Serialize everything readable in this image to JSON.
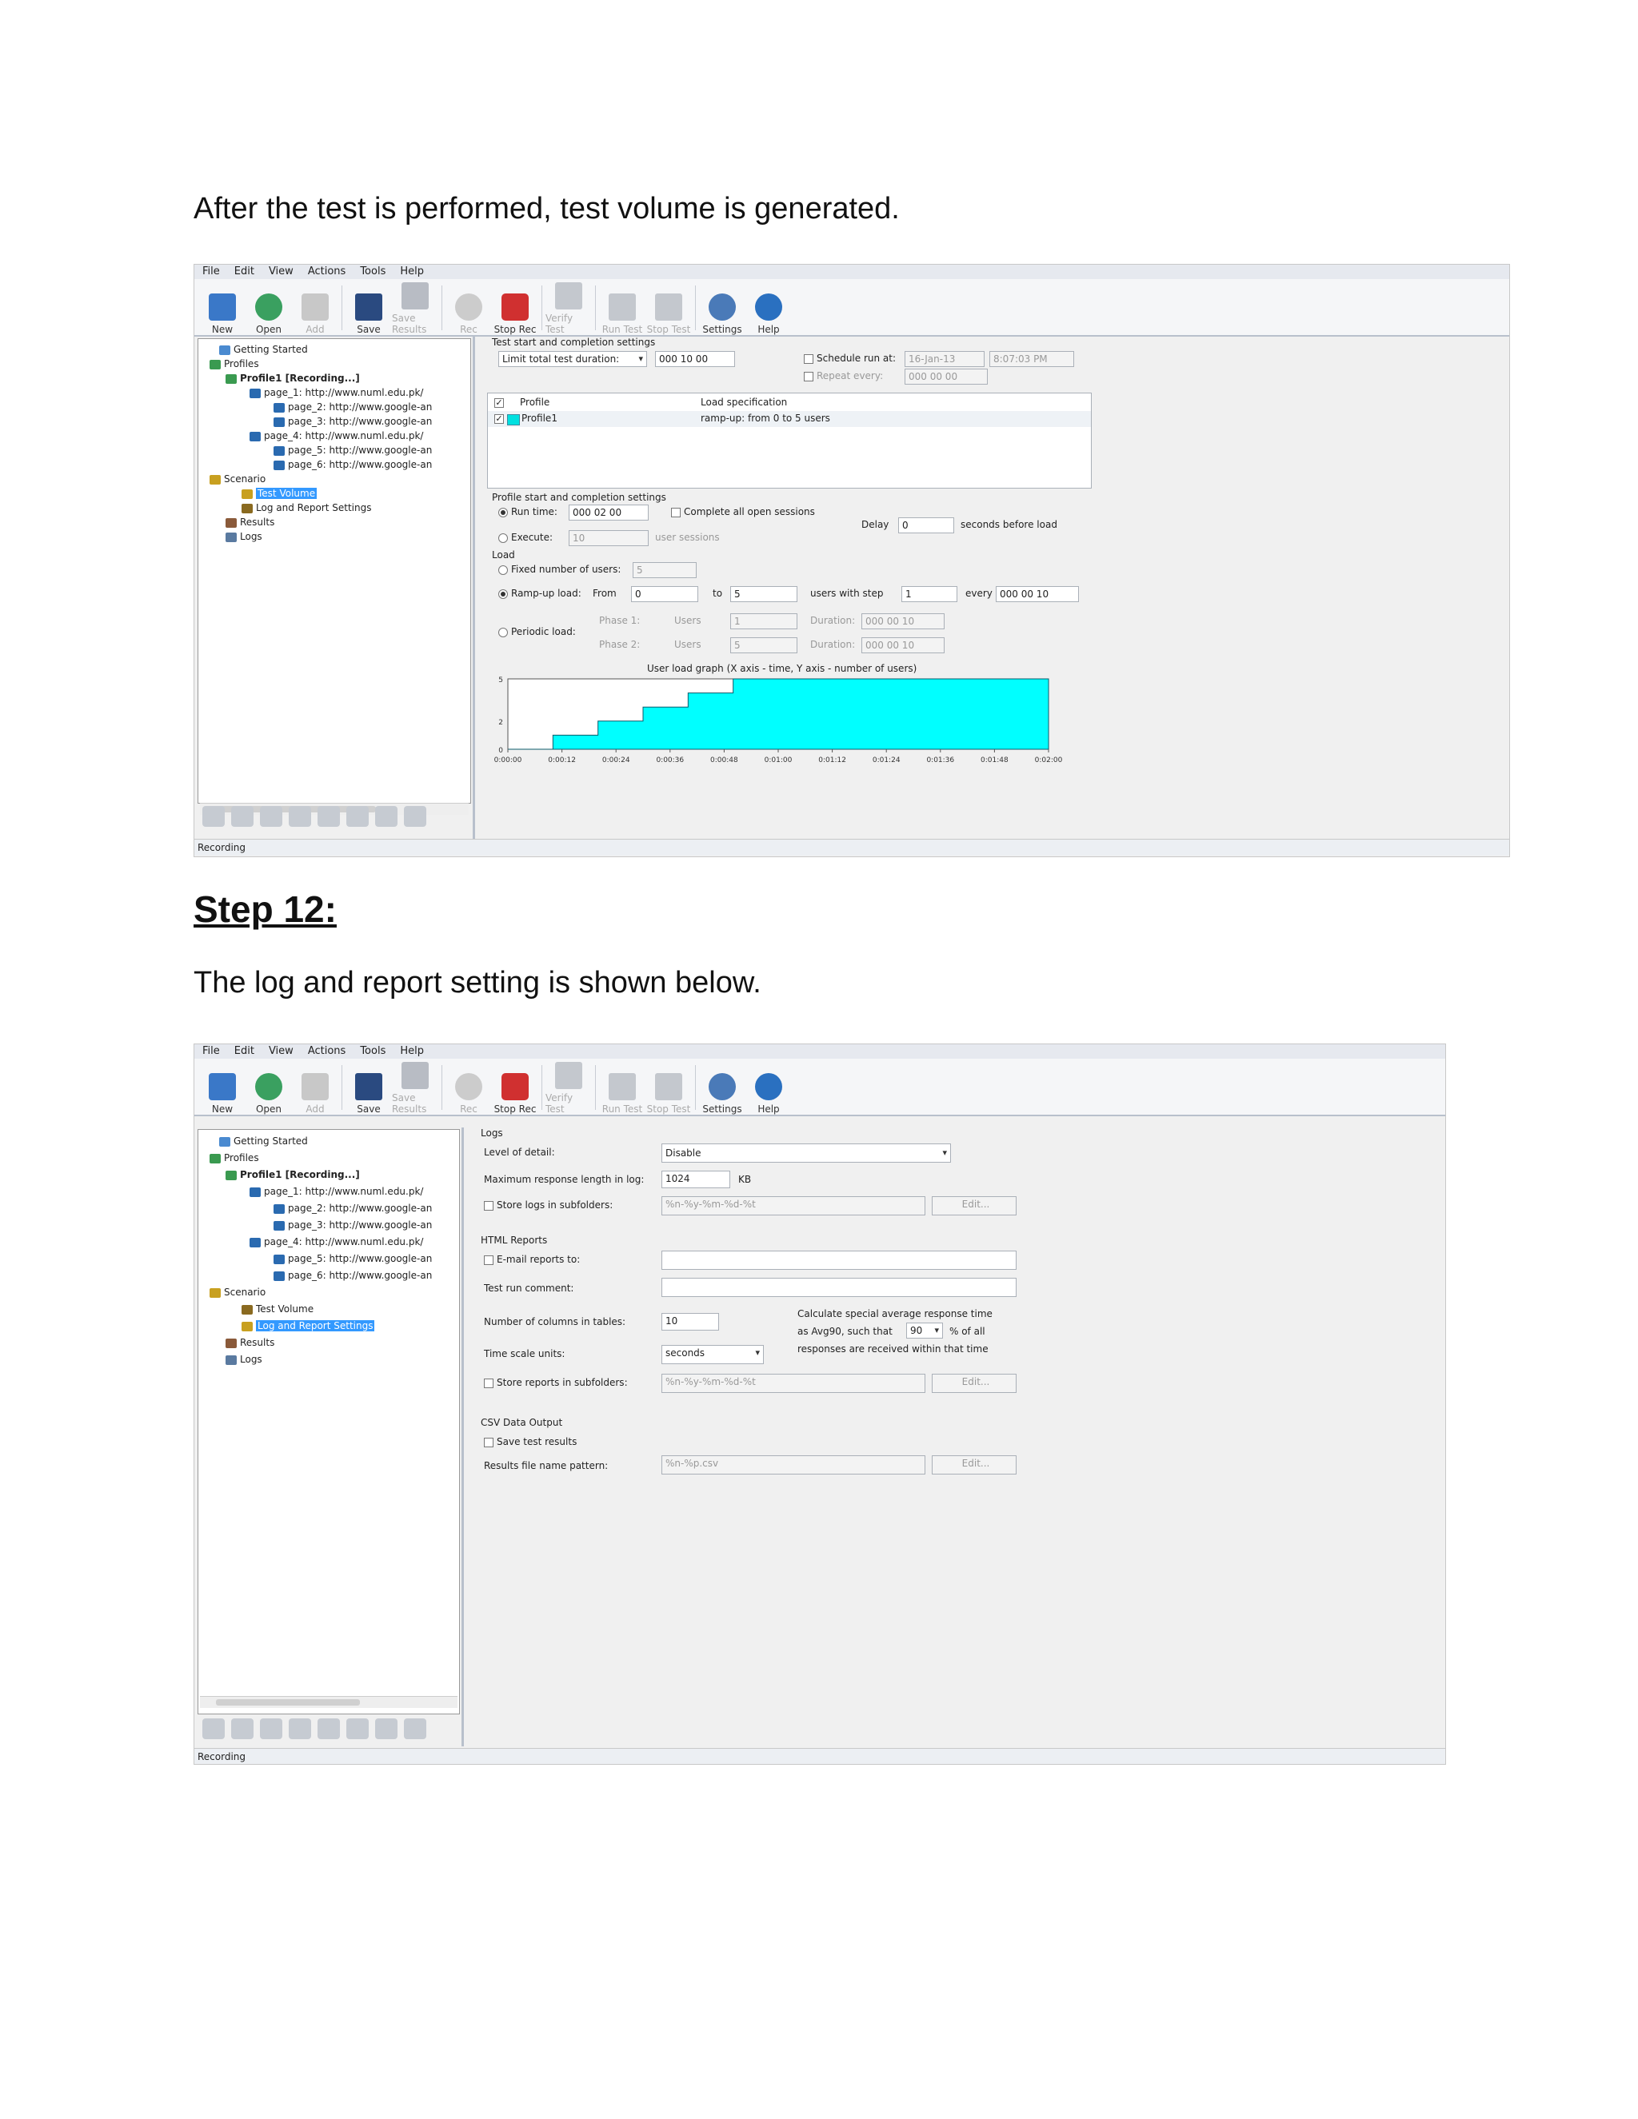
{
  "doc": {
    "intro": "After the test is performed, test volume is generated.",
    "step_heading": "Step 12:",
    "step_text": "The log and report setting is shown below."
  },
  "app": {
    "menu": [
      "File",
      "Edit",
      "View",
      "Actions",
      "Tools",
      "Help"
    ],
    "toolbar": {
      "new": "New",
      "open": "Open",
      "add": "Add",
      "save": "Save",
      "save_results": "Save Results",
      "rec": "Rec",
      "stop_rec": "Stop Rec",
      "verify_test": "Verify Test",
      "run_test": "Run Test",
      "stop_test": "Stop Test",
      "settings": "Settings",
      "help": "Help"
    },
    "status": "Recording"
  },
  "tree1": {
    "items": [
      "Getting Started",
      "Profiles",
      "Profile1 [Recording...]",
      "page_1: http://www.numl.edu.pk/",
      "page_2: http://www.google-an",
      "page_3: http://www.google-an",
      "page_4: http://www.numl.edu.pk/",
      "page_5: http://www.google-an",
      "page_6: http://www.google-an",
      "Scenario",
      "Test Volume",
      "Log and Report Settings",
      "Results",
      "Logs"
    ]
  },
  "tree2": {
    "items": [
      "Getting Started",
      "Profiles",
      "Profile1 [Recording...]",
      "page_1: http://www.numl.edu.pk/",
      "page_2: http://www.google-an",
      "page_3: http://www.google-an",
      "page_4: http://www.numl.edu.pk/",
      "page_5: http://www.google-an",
      "page_6: http://www.google-an",
      "Scenario",
      "Test Volume",
      "Log and Report Settings",
      "Results",
      "Logs"
    ]
  },
  "volume": {
    "test_settings_title": "Test start and completion settings",
    "duration_select": "Limit total test duration:",
    "duration_value": "000 10 00",
    "schedule_label": "Schedule run at:",
    "schedule_date": "16-Jan-13",
    "schedule_time": "8:07:03 PM",
    "repeat_label": "Repeat every:",
    "repeat_value": "000 00 00",
    "table_col1": "Profile",
    "table_col2": "Load specification",
    "row_profile": "Profile1",
    "row_spec": "ramp-up: from 0 to 5 users",
    "profile_settings_title": "Profile start and completion settings",
    "run_time_label": "Run time:",
    "run_time_value": "000 02 00",
    "complete_sessions": "Complete all open sessions",
    "delay_label": "Delay",
    "delay_value": "0",
    "delay_suffix": "seconds before load",
    "execute_label": "Execute:",
    "execute_value": "10",
    "user_sessions": "user sessions",
    "load_title": "Load",
    "fixed_label": "Fixed number of users:",
    "fixed_value": "5",
    "ramp_label": "Ramp-up load:",
    "from_label": "From",
    "from_value": "0",
    "to_label": "to",
    "to_value": "5",
    "users_step": "users with step",
    "step_value": "1",
    "every_label": "every",
    "every_value": "000 00 10",
    "periodic_label": "Periodic load:",
    "phase1": "Phase 1:",
    "phase2": "Phase 2:",
    "users_label": "Users",
    "p1_users": "1",
    "p2_users": "5",
    "duration_label": "Duration:",
    "p1_duration": "000 00 10",
    "p2_duration": "000 00 10",
    "graph_title": "User load graph (X axis - time, Y axis - number of users)"
  },
  "chart_data": {
    "type": "area",
    "title": "User load graph (X axis - time, Y axis - number of users)",
    "xlabel": "time",
    "ylabel": "number of users",
    "x_ticks": [
      "0:00:00",
      "0:00:12",
      "0:00:24",
      "0:00:36",
      "0:00:48",
      "0:01:00",
      "0:01:12",
      "0:01:24",
      "0:01:36",
      "0:01:48",
      "0:02:00"
    ],
    "y_ticks": [
      "0",
      "2",
      "5"
    ],
    "xlim_seconds": [
      0,
      120
    ],
    "ylim": [
      0,
      5
    ],
    "series": [
      {
        "x_seconds": [
          0,
          10,
          20,
          30,
          40,
          50,
          120
        ],
        "y": [
          0,
          1,
          2,
          3,
          4,
          5,
          5
        ]
      }
    ],
    "fill_color": "#00ffff"
  },
  "logs": {
    "logs_title": "Logs",
    "level_label": "Level of detail:",
    "level_value": "Disable",
    "max_len_label": "Maximum response length in log:",
    "max_len_value": "1024",
    "kb": "KB",
    "store_logs": "Store logs in subfolders:",
    "logs_pattern": "%n-%y-%m-%d-%t",
    "edit": "Edit...",
    "html_title": "HTML Reports",
    "email_label": "E-mail reports to:",
    "comment_label": "Test run comment:",
    "columns_label": "Number of columns in tables:",
    "columns_value": "10",
    "calc_line1": "Calculate special average response time",
    "calc_line2a": "as Avg90, such that",
    "calc_value": "90",
    "calc_line2b": "% of all",
    "calc_line3": "responses are received within that time",
    "time_scale_label": "Time scale units:",
    "time_scale_value": "seconds",
    "store_reports": "Store reports in subfolders:",
    "reports_pattern": "%n-%y-%m-%d-%t",
    "csv_title": "CSV Data Output",
    "save_results": "Save test results",
    "file_pattern_label": "Results file name pattern:",
    "file_pattern_value": "%n-%p.csv"
  }
}
